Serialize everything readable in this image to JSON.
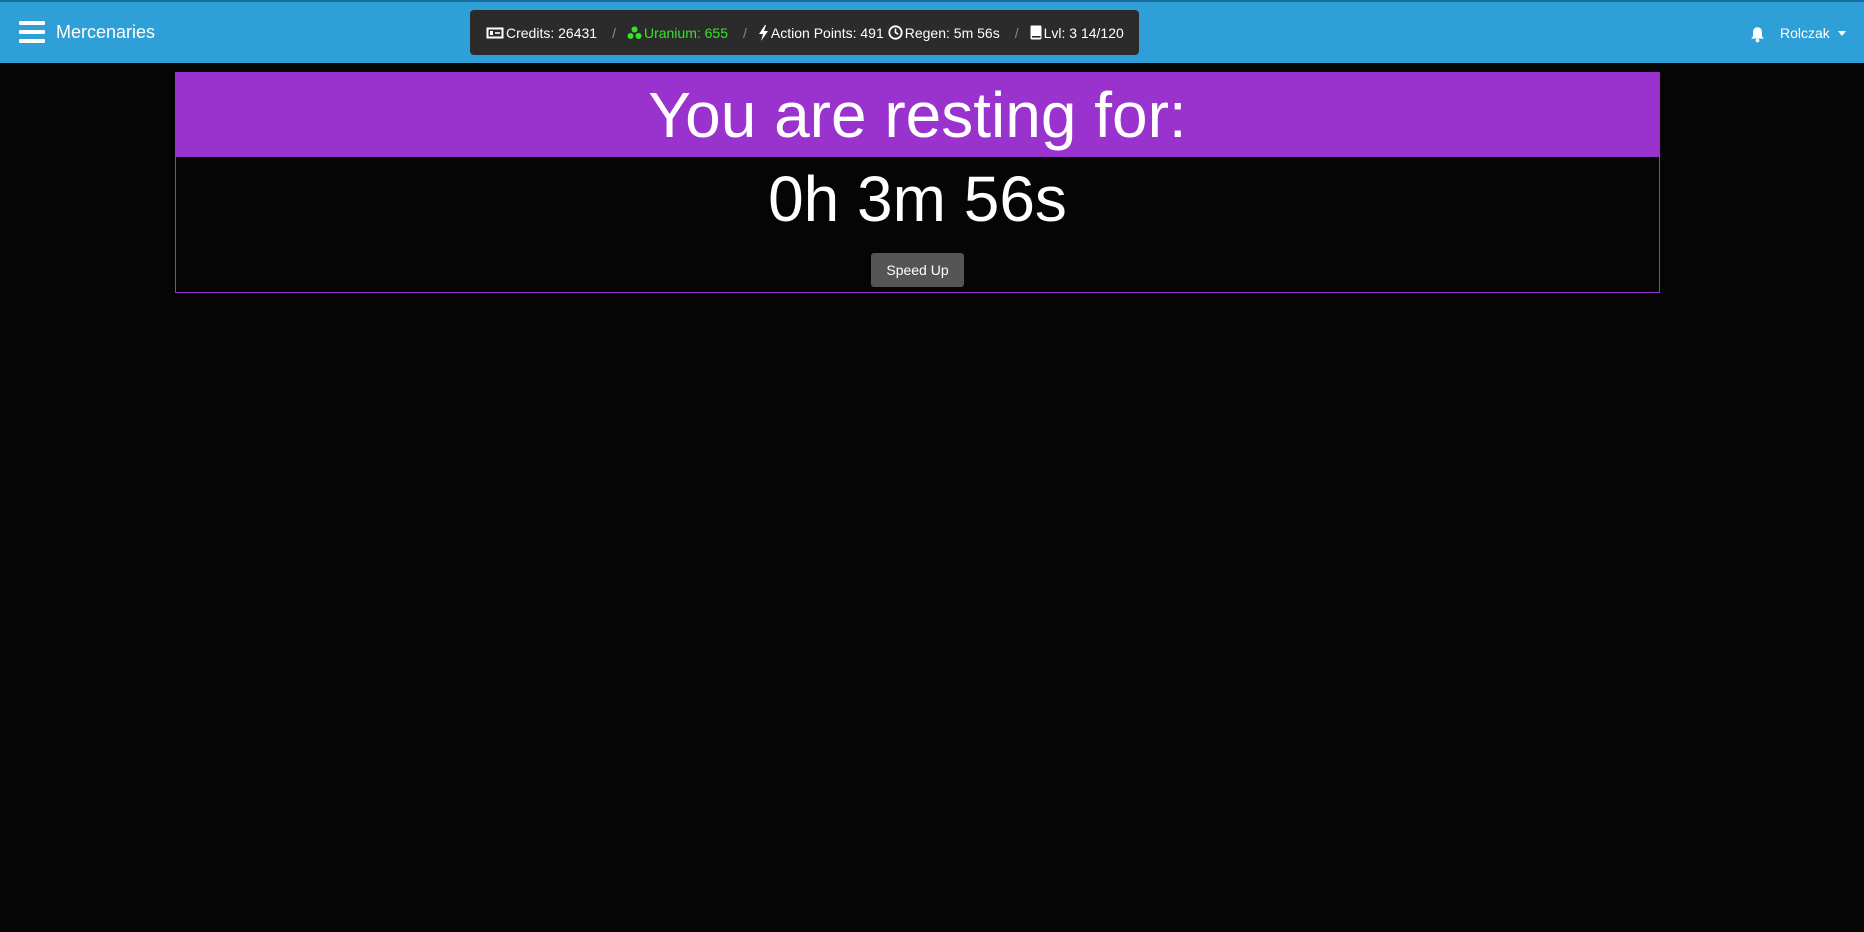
{
  "navbar": {
    "brand": "Mercenaries",
    "bg_color": "#2f9fd8"
  },
  "stats": {
    "credits": "Credits: 26431",
    "uranium": "Uranium: 655",
    "action_points": "Action Points: 491",
    "regen": "Regen: 5m 56s",
    "level": "Lvl: 3 14/120",
    "separator": "/",
    "uranium_color": "#39e22a"
  },
  "user": {
    "name": "Rolczak"
  },
  "rest": {
    "title": "You are resting for:",
    "timer": "0h 3m 56s",
    "speed_up_label": "Speed Up",
    "accent_color": "#9a32cd"
  },
  "icons": {
    "menu": "hamburger-menu-icon",
    "credits": "money-bill-icon",
    "uranium": "radiation-icon",
    "action_points": "lightning-bolt-icon",
    "regen": "clock-icon",
    "level": "book-icon",
    "notifications": "bell-icon",
    "user_caret": "caret-down-icon"
  }
}
